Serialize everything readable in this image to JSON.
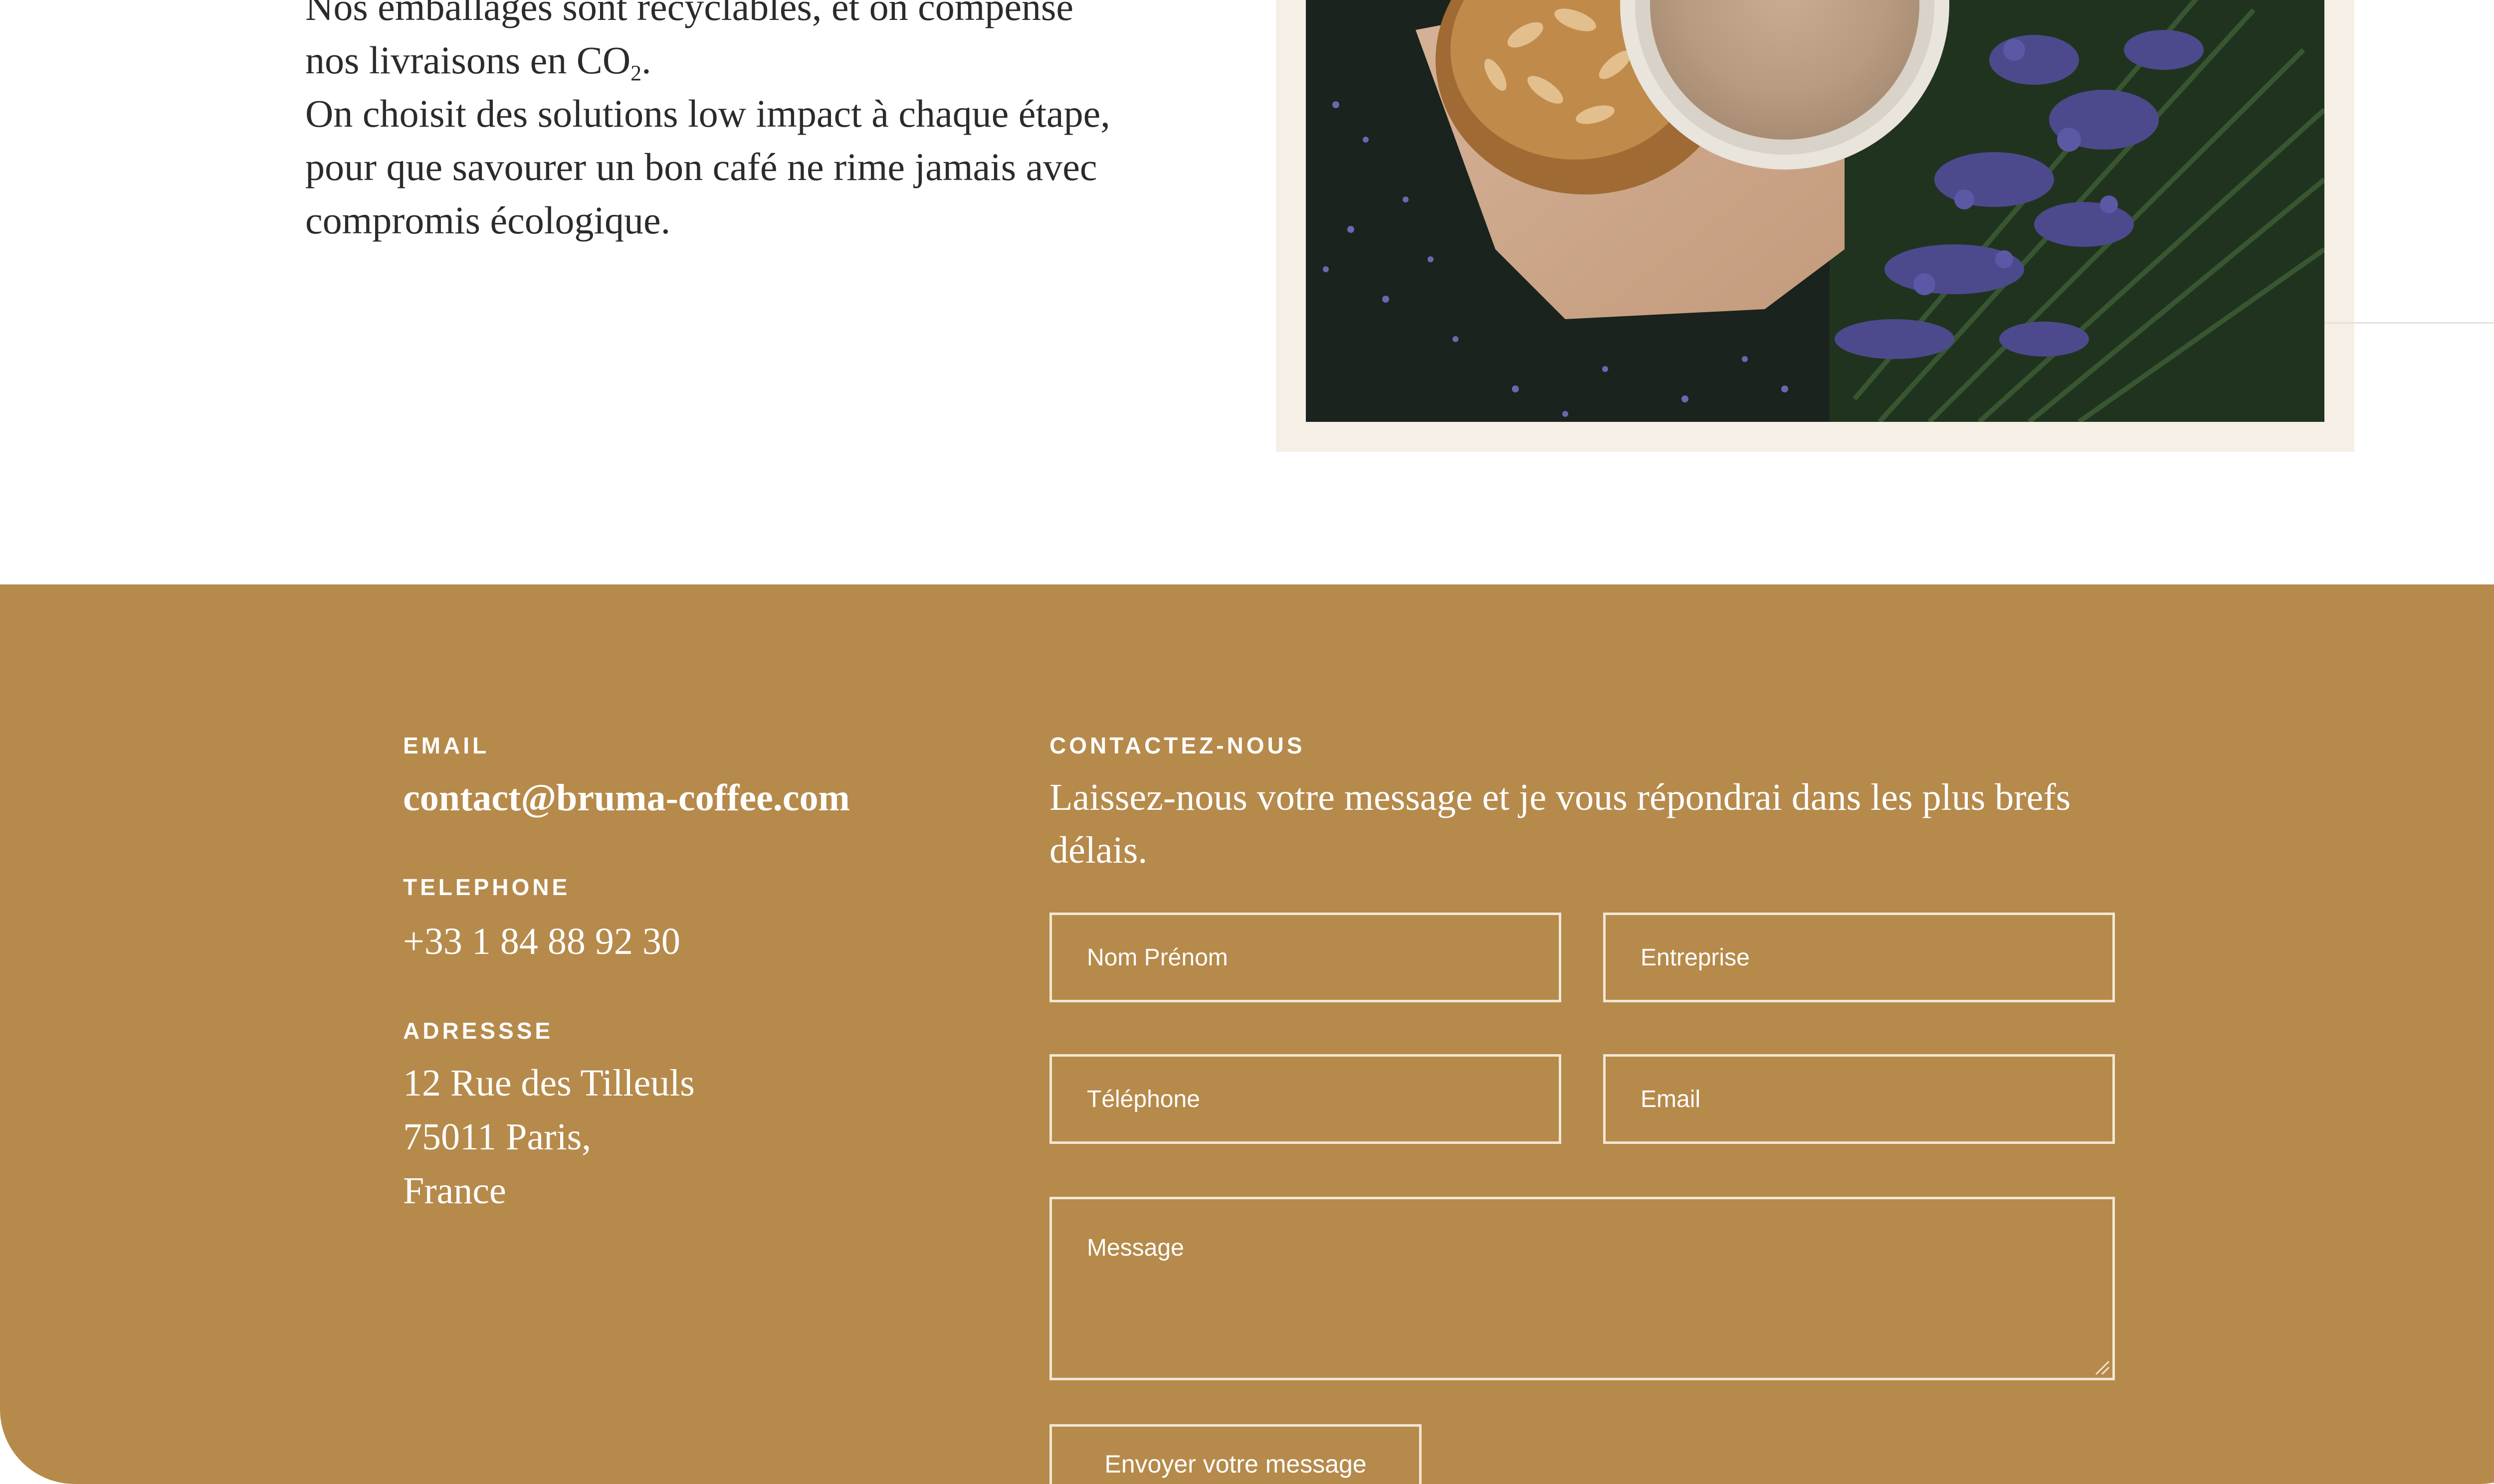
{
  "about": {
    "line1": "Nos emballages sont recyclables, et on compense",
    "line2_before": "nos livraisons en CO",
    "line2_sub": "2",
    "line2_after": ".",
    "paragraph2": "On choisit des solutions low impact à chaque étape, pour que savourer un bon café ne rime jamais avec compromis écologique."
  },
  "contact_info": {
    "email_label": "EMAIL",
    "email_value": "contact@bruma-coffee.com",
    "phone_label": "TELEPHONE",
    "phone_value": "+33 1 84 88 92 30",
    "address_label": "ADRESSSE",
    "address_lines": [
      "12 Rue des Tilleuls",
      "75011 Paris,",
      "France"
    ]
  },
  "contact_form": {
    "heading": "CONTACTEZ-NOUS",
    "intro": "Laissez-nous votre message et je vous répondrai dans les plus brefs délais.",
    "name_placeholder": "Nom Prénom",
    "company_placeholder": "Entreprise",
    "phone_placeholder": "Téléphone",
    "email_placeholder": "Email",
    "message_placeholder": "Message",
    "submit_label": "Envoyer votre message"
  },
  "colors": {
    "footer_bg": "#b68a4b",
    "field_border": "#f3e6d4",
    "photo_frame": "#f6efe6"
  }
}
